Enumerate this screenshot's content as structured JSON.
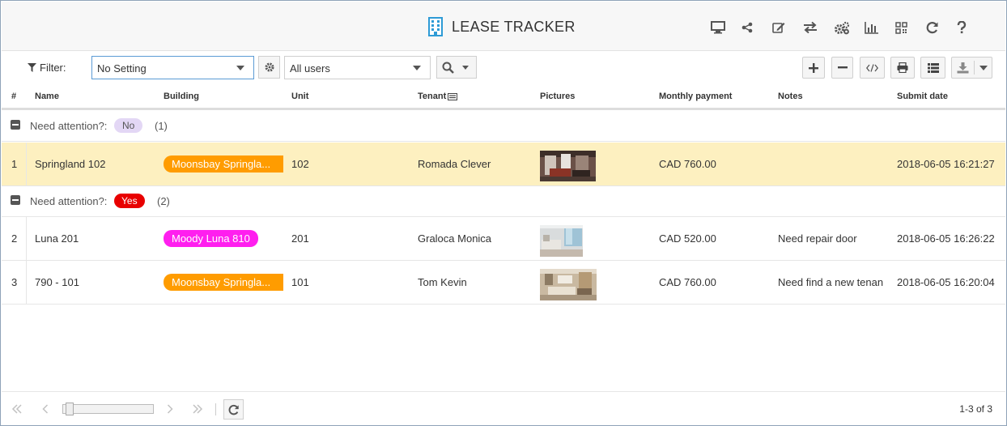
{
  "app": {
    "title": "LEASE TRACKER"
  },
  "header_icons": [
    "monitor-icon",
    "share-icon",
    "edit-icon",
    "exchange-icon",
    "gears-icon",
    "bar-chart-icon",
    "qr-code-icon",
    "refresh-icon",
    "help-icon"
  ],
  "toolbar": {
    "filter_label": "Filter:",
    "filter_value": "No Setting",
    "users_value": "All users"
  },
  "columns": [
    "#",
    "Name",
    "Building",
    "Unit",
    "Tenant",
    "Pictures",
    "Monthly payment",
    "Notes",
    "Submit date"
  ],
  "groups": [
    {
      "label": "Need attention?:",
      "value": "No",
      "count": "(1)",
      "rows": [
        {
          "index": "1",
          "name": "Springland 102",
          "building": "Moonsbay Springla...",
          "unit": "102",
          "tenant": "Romada Clever",
          "payment": "CAD 760.00",
          "notes": "",
          "date": "2018-06-05 16:21:27"
        }
      ]
    },
    {
      "label": "Need attention?:",
      "value": "Yes",
      "count": "(2)",
      "rows": [
        {
          "index": "2",
          "name": "Luna 201",
          "building": "Moody Luna 810",
          "unit": "201",
          "tenant": "Graloca Monica",
          "payment": "CAD 520.00",
          "notes": "Need repair door",
          "date": "2018-06-05 16:26:22"
        },
        {
          "index": "3",
          "name": "790 - 101",
          "building": "Moonsbay Springla...",
          "unit": "101",
          "tenant": "Tom Kevin",
          "payment": "CAD 760.00",
          "notes": "Need find a new tenan",
          "date": "2018-06-05 16:20:04"
        }
      ]
    }
  ],
  "pagination": {
    "info": "1-3 of 3"
  },
  "colors": {
    "orange_tag": "#ff9c00",
    "magenta_tag": "#ff1fef",
    "selected_row": "#fdf0c0",
    "yes_badge": "#e80000",
    "no_badge": "#e3d7f5"
  }
}
